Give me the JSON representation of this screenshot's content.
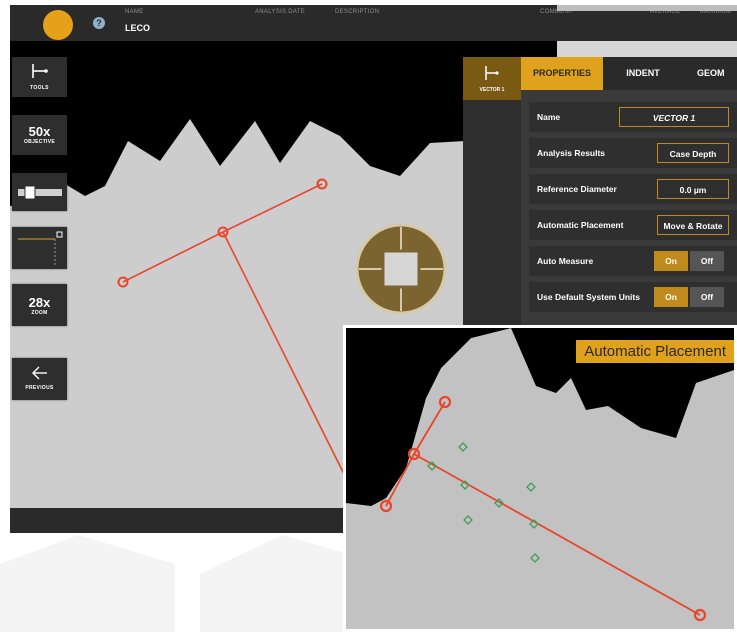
{
  "header": {
    "columns": [
      "NAME",
      "ANALYSIS DATE",
      "DESCRIPTION",
      "COMMENT",
      "AVERAGE",
      "MAXIMUM"
    ],
    "name_value": "LECO",
    "help_glyph": "?"
  },
  "toolbar": {
    "tools_label": "TOOLS",
    "objective_value": "50x",
    "objective_label": "OBJECTIVE",
    "zoom_value": "28x",
    "zoom_label": "ZOOM",
    "previous_label": "PREVIOUS"
  },
  "panel": {
    "vector_label": "VECTOR 1",
    "tabs": [
      "PROPERTIES",
      "INDENT",
      "GEOM"
    ],
    "rows": {
      "name_label": "Name",
      "name_value": "VECTOR 1",
      "analysis_label": "Analysis Results",
      "analysis_value": "Case Depth",
      "diameter_label": "Reference Diameter",
      "diameter_value": "0.0 µm",
      "placement_label": "Automatic Placement",
      "placement_value": "Move & Rotate",
      "auto_measure_label": "Auto Measure",
      "default_units_label": "Use Default System Units",
      "on": "On",
      "off": "Off"
    }
  },
  "inset": {
    "label": "Automatic Placement"
  },
  "colors": {
    "accent": "#e0a21d",
    "vector": "#e8452b",
    "marker": "#3f9e5a"
  }
}
